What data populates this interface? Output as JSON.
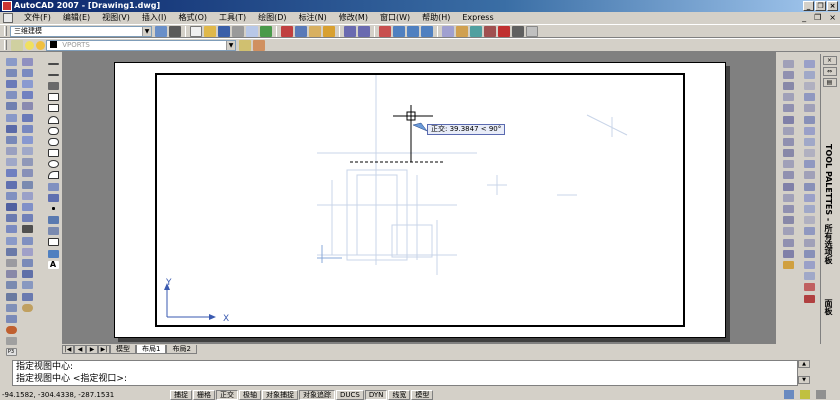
{
  "window": {
    "title": "AutoCAD 2007 - [Drawing1.dwg]"
  },
  "menu": {
    "items": [
      "文件(F)",
      "编辑(E)",
      "视图(V)",
      "插入(I)",
      "格式(O)",
      "工具(T)",
      "绘图(D)",
      "标注(N)",
      "修改(M)",
      "窗口(W)",
      "帮助(H)",
      "Express"
    ]
  },
  "toolbar": {
    "workspace": "三维建模",
    "layer": "VPORTS"
  },
  "drawing": {
    "tooltip": "正交: 39.3847 < 90°",
    "ucs_x": "X",
    "ucs_y": "Y"
  },
  "layout_tabs": [
    "模型",
    "布局1",
    "布局2"
  ],
  "command": {
    "history": "指定视图中心:",
    "prompt": "指定视图中心 <指定视口>:"
  },
  "status": {
    "coords": "-94.1582,  -304.4338,  -287.1531",
    "buttons": [
      "捕捉",
      "栅格",
      "正交",
      "极轴",
      "对象捕捉",
      "对象追踪",
      "DUCS",
      "DYN",
      "线宽",
      "模型"
    ],
    "active": [
      "正交",
      "对象追踪",
      "DYN"
    ]
  },
  "palette": {
    "title": "TOOL PALETTES - 所有选项板",
    "tab": "面板"
  },
  "icons": [
    "autocad-logo-icon",
    "minimize-icon",
    "restore-icon",
    "close-icon",
    "new-file-icon",
    "open-icon",
    "save-icon",
    "print-icon",
    "undo-icon",
    "redo-icon",
    "zoom-icon",
    "pan-icon",
    "line-icon",
    "circle-icon",
    "arc-icon",
    "rectangle-icon",
    "text-icon",
    "hatch-icon"
  ]
}
